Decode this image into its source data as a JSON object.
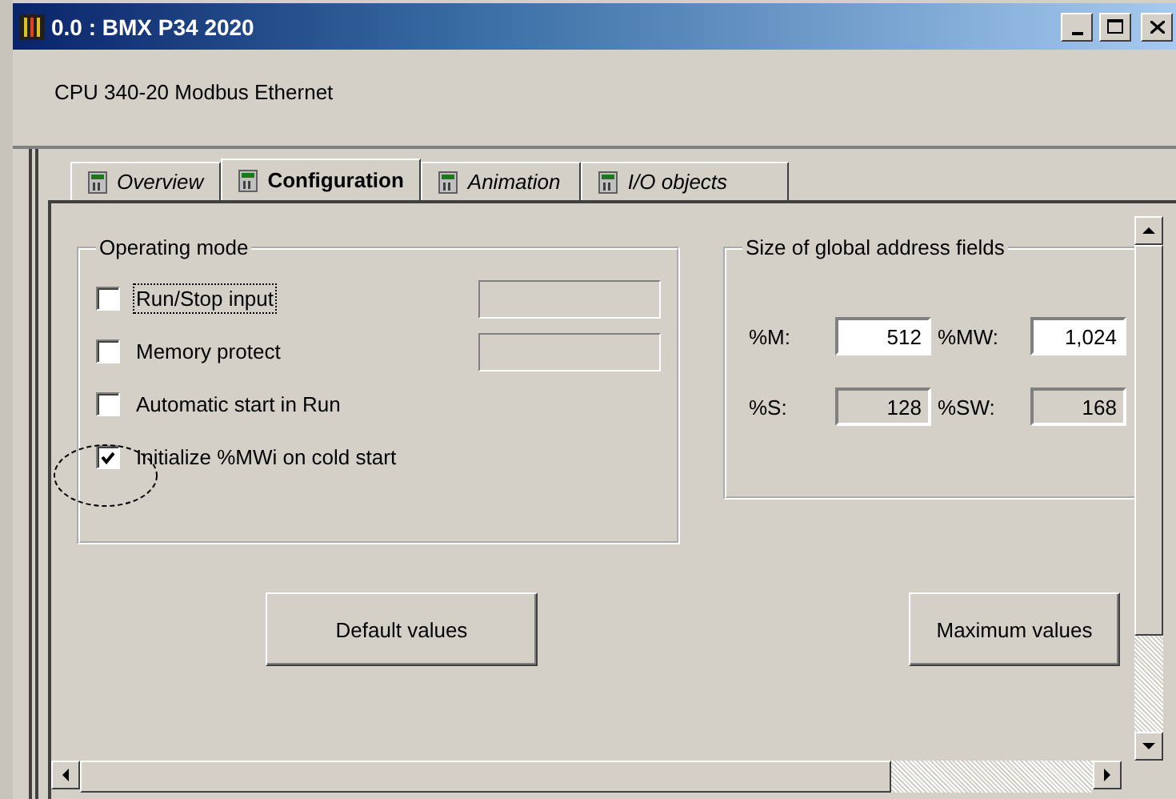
{
  "window": {
    "title": "0.0 : BMX P34 2020"
  },
  "header": {
    "description": "CPU 340-20 Modbus Ethernet"
  },
  "tabs": [
    {
      "label": "Overview",
      "selected": false
    },
    {
      "label": "Configuration",
      "selected": true
    },
    {
      "label": "Animation",
      "selected": false
    },
    {
      "label": "I/O objects",
      "selected": false
    }
  ],
  "operating_mode": {
    "title": "Operating mode",
    "options": [
      {
        "label": "Run/Stop input",
        "checked": false,
        "kind": "with_field",
        "focused": true
      },
      {
        "label": "Memory protect",
        "checked": false,
        "kind": "with_field",
        "focused": false
      },
      {
        "label": "Automatic start in Run",
        "checked": false,
        "kind": "plain",
        "focused": false
      },
      {
        "label": "Initialize %MWi on cold start",
        "checked": true,
        "kind": "plain",
        "focused": false,
        "circled": true
      }
    ]
  },
  "address_fields": {
    "title": "Size of global address fields",
    "fields": [
      {
        "label": "%M:",
        "value": "512",
        "editable": true
      },
      {
        "label": "%MW:",
        "value": "1,024",
        "editable": true
      },
      {
        "label": "%S:",
        "value": "128",
        "editable": false
      },
      {
        "label": "%SW:",
        "value": "168",
        "editable": false
      }
    ]
  },
  "buttons": [
    {
      "label": "Default values"
    },
    {
      "label": "Maximum values"
    }
  ]
}
